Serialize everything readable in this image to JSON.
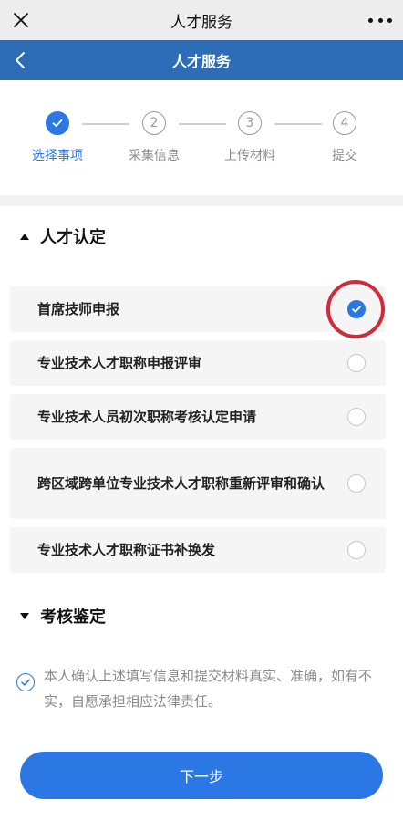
{
  "wechat_bar": {
    "title": "人才服务"
  },
  "header": {
    "title": "人才服务"
  },
  "steps": [
    {
      "number": "1",
      "label": "选择事项",
      "state": "done"
    },
    {
      "number": "2",
      "label": "采集信息",
      "state": "pending"
    },
    {
      "number": "3",
      "label": "上传材料",
      "state": "pending"
    },
    {
      "number": "4",
      "label": "提交",
      "state": "pending"
    }
  ],
  "sections": [
    {
      "title": "人才认定",
      "expanded": true,
      "options": [
        {
          "label": "首席技师申报",
          "selected": true
        },
        {
          "label": "专业技术人才职称申报评审",
          "selected": false
        },
        {
          "label": "专业技术人员初次职称考核认定申请",
          "selected": false
        },
        {
          "label": "跨区域跨单位专业技术人才职称重新评审和确认",
          "selected": false
        },
        {
          "label": "专业技术人才职称证书补换发",
          "selected": false
        }
      ]
    },
    {
      "title": "考核鉴定",
      "expanded": false,
      "options": []
    }
  ],
  "consent": {
    "text": "本人确认上述填写信息和提交材料真实、准确，如有不实，自愿承担相应法律责任。",
    "checked": true
  },
  "next_button": {
    "label": "下一步"
  },
  "colors": {
    "brand_blue": "#2b78e4",
    "header_blue": "#2c6db5",
    "highlight_ring": "#cf2b3a"
  }
}
